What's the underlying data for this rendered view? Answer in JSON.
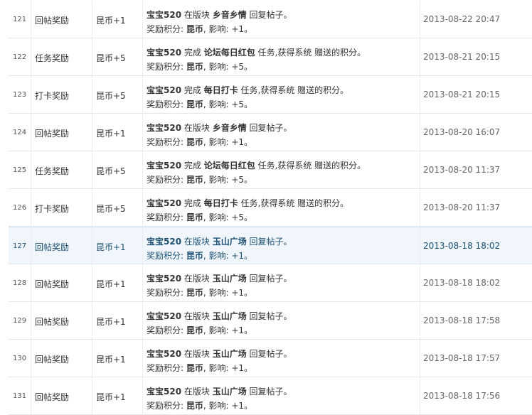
{
  "rows": [
    {
      "id": "121",
      "type": "回帖奖励",
      "change": "昆币+1",
      "user": "宝宝520",
      "line1": [
        " 在版块 ",
        "乡音乡情",
        " 回复帖子。"
      ],
      "line2_prefix": "奖励积分: ",
      "line2_currency": "昆币",
      "line2_suffix": ", 影响: +1。",
      "time": "2013-08-22 20:47",
      "hover": false
    },
    {
      "id": "122",
      "type": "任务奖励",
      "change": "昆币+5",
      "user": "宝宝520",
      "line1": [
        " 完成 ",
        "论坛每日红包",
        " 任务,获得系统 赠送的积分。"
      ],
      "line2_prefix": "奖励积分: ",
      "line2_currency": "昆币",
      "line2_suffix": ", 影响: +5。",
      "time": "2013-08-21 20:15",
      "hover": false
    },
    {
      "id": "123",
      "type": "打卡奖励",
      "change": "昆币+5",
      "user": "宝宝520",
      "line1": [
        " 完成 ",
        "每日打卡",
        " 任务,获得系统 赠送的积分。"
      ],
      "line2_prefix": "奖励积分: ",
      "line2_currency": "昆币",
      "line2_suffix": ", 影响: +5。",
      "time": "2013-08-21 20:15",
      "hover": false
    },
    {
      "id": "124",
      "type": "回帖奖励",
      "change": "昆币+1",
      "user": "宝宝520",
      "line1": [
        " 在版块 ",
        "乡音乡情",
        " 回复帖子。"
      ],
      "line2_prefix": "奖励积分: ",
      "line2_currency": "昆币",
      "line2_suffix": ", 影响: +1。",
      "time": "2013-08-20 16:07",
      "hover": false
    },
    {
      "id": "125",
      "type": "任务奖励",
      "change": "昆币+5",
      "user": "宝宝520",
      "line1": [
        " 完成 ",
        "论坛每日红包",
        " 任务,获得系统 赠送的积分。"
      ],
      "line2_prefix": "奖励积分: ",
      "line2_currency": "昆币",
      "line2_suffix": ", 影响: +5。",
      "time": "2013-08-20 11:37",
      "hover": false
    },
    {
      "id": "126",
      "type": "打卡奖励",
      "change": "昆币+5",
      "user": "宝宝520",
      "line1": [
        " 完成 ",
        "每日打卡",
        " 任务,获得系统 赠送的积分。"
      ],
      "line2_prefix": "奖励积分: ",
      "line2_currency": "昆币",
      "line2_suffix": ", 影响: +5。",
      "time": "2013-08-20 11:37",
      "hover": false
    },
    {
      "id": "127",
      "type": "回帖奖励",
      "change": "昆币+1",
      "user": "宝宝520",
      "line1": [
        " 在版块 ",
        "玉山广场",
        " 回复帖子。"
      ],
      "line2_prefix": "奖励积分: ",
      "line2_currency": "昆币",
      "line2_suffix": ", 影响: +1。",
      "time": "2013-08-18 18:02",
      "hover": true
    },
    {
      "id": "128",
      "type": "回帖奖励",
      "change": "昆币+1",
      "user": "宝宝520",
      "line1": [
        " 在版块 ",
        "玉山广场",
        " 回复帖子。"
      ],
      "line2_prefix": "奖励积分: ",
      "line2_currency": "昆币",
      "line2_suffix": ", 影响: +1。",
      "time": "2013-08-18 18:02",
      "hover": false
    },
    {
      "id": "129",
      "type": "回帖奖励",
      "change": "昆币+1",
      "user": "宝宝520",
      "line1": [
        " 在版块 ",
        "玉山广场",
        " 回复帖子。"
      ],
      "line2_prefix": "奖励积分: ",
      "line2_currency": "昆币",
      "line2_suffix": ", 影响: +1。",
      "time": "2013-08-18 17:58",
      "hover": false
    },
    {
      "id": "130",
      "type": "回帖奖励",
      "change": "昆币+1",
      "user": "宝宝520",
      "line1": [
        " 在版块 ",
        "玉山广场",
        " 回复帖子。"
      ],
      "line2_prefix": "奖励积分: ",
      "line2_currency": "昆币",
      "line2_suffix": ", 影响: +1。",
      "time": "2013-08-18 17:57",
      "hover": false
    },
    {
      "id": "131",
      "type": "回帖奖励",
      "change": "昆币+1",
      "user": "宝宝520",
      "line1": [
        " 在版块 ",
        "玉山广场",
        " 回复帖子。"
      ],
      "line2_prefix": "奖励积分: ",
      "line2_currency": "昆币",
      "line2_suffix": ", 影响: +1。",
      "time": "2013-08-18 17:56",
      "hover": false
    }
  ]
}
